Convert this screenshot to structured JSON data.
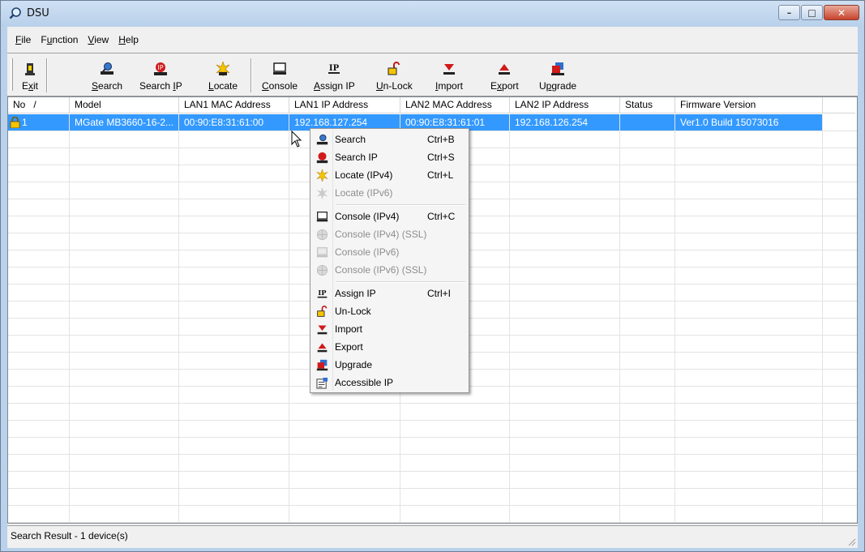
{
  "window": {
    "title": "DSU",
    "controls": [
      "minimize",
      "maximize",
      "close"
    ]
  },
  "menubar": {
    "items": [
      "File",
      "Function",
      "View",
      "Help"
    ]
  },
  "toolbar": {
    "buttons": [
      {
        "label": "Exit",
        "icon": "exit-icon"
      },
      {
        "label": "Search",
        "icon": "search-icon"
      },
      {
        "label": "Search IP",
        "icon": "search-ip-icon"
      },
      {
        "label": "Locate",
        "icon": "locate-icon"
      },
      {
        "label": "Console",
        "icon": "console-icon"
      },
      {
        "label": "Assign IP",
        "icon": "assign-ip-icon"
      },
      {
        "label": "Un-Lock",
        "icon": "unlock-icon"
      },
      {
        "label": "Import",
        "icon": "import-icon"
      },
      {
        "label": "Export",
        "icon": "export-icon"
      },
      {
        "label": "Upgrade",
        "icon": "upgrade-icon"
      }
    ]
  },
  "table": {
    "columns": [
      "No",
      "Model",
      "LAN1 MAC Address",
      "LAN1 IP Address",
      "LAN2 MAC Address",
      "LAN2 IP Address",
      "Status",
      "Firmware Version"
    ],
    "sort_indicator": "/",
    "rows": [
      {
        "no": "1",
        "model": "MGate MB3660-16-2...",
        "lan1_mac": "00:90:E8:31:61:00",
        "lan1_ip": "192.168.127.254",
        "lan2_mac": "00:90:E8:31:61:01",
        "lan2_ip": "192.168.126.254",
        "status": "",
        "firmware": "Ver1.0 Build 15073016",
        "locked": true
      }
    ]
  },
  "context_menu": {
    "items": [
      {
        "label": "Search",
        "shortcut": "Ctrl+B",
        "icon": "search-icon",
        "enabled": true
      },
      {
        "label": "Search IP",
        "shortcut": "Ctrl+S",
        "icon": "search-ip-icon",
        "enabled": true
      },
      {
        "label": "Locate (IPv4)",
        "shortcut": "Ctrl+L",
        "icon": "locate-icon",
        "enabled": true
      },
      {
        "label": "Locate (IPv6)",
        "shortcut": "",
        "icon": "locate-icon",
        "enabled": false
      },
      {
        "separator": true
      },
      {
        "label": "Console (IPv4)",
        "shortcut": "Ctrl+C",
        "icon": "console-icon",
        "enabled": true
      },
      {
        "label": "Console (IPv4) (SSL)",
        "shortcut": "",
        "icon": "globe-icon",
        "enabled": false
      },
      {
        "label": "Console (IPv6)",
        "shortcut": "",
        "icon": "console-icon",
        "enabled": false
      },
      {
        "label": "Console (IPv6) (SSL)",
        "shortcut": "",
        "icon": "globe-icon",
        "enabled": false
      },
      {
        "separator": true
      },
      {
        "label": "Assign IP",
        "shortcut": "Ctrl+I",
        "icon": "assign-ip-icon",
        "enabled": true
      },
      {
        "label": "Un-Lock",
        "shortcut": "",
        "icon": "unlock-icon",
        "enabled": true
      },
      {
        "label": "Import",
        "shortcut": "",
        "icon": "import-icon",
        "enabled": true
      },
      {
        "label": "Export",
        "shortcut": "",
        "icon": "export-icon",
        "enabled": true
      },
      {
        "label": "Upgrade",
        "shortcut": "",
        "icon": "upgrade-icon",
        "enabled": true
      },
      {
        "label": "Accessible IP",
        "shortcut": "",
        "icon": "accessible-ip-icon",
        "enabled": true
      }
    ]
  },
  "statusbar": {
    "text": "Search Result - 1 device(s)"
  },
  "colors": {
    "selection": "#3399ff",
    "titlebar": "#b9d1ea",
    "close_button": "#c7432c"
  }
}
